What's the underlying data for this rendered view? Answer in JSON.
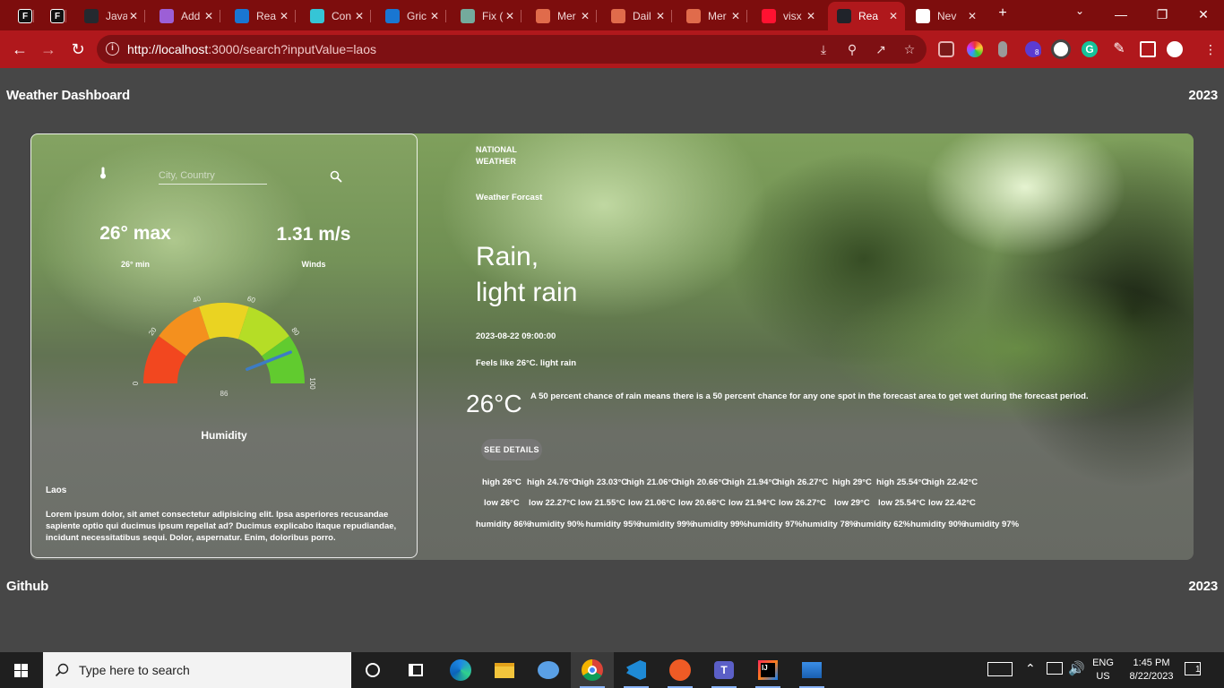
{
  "browser": {
    "tabs": [
      {
        "title": "",
        "icon": "figma-f",
        "color": "#1e1e1e",
        "glyph": "F"
      },
      {
        "title": "",
        "icon": "figma-f",
        "color": "#1e1e1e",
        "glyph": "F"
      },
      {
        "title": "Java",
        "icon": "github-icon",
        "color": "#24292f",
        "glyph": ""
      },
      {
        "title": "Add",
        "icon": "avatar-icon",
        "color": "#9c5fd6",
        "glyph": ""
      },
      {
        "title": "Rea",
        "icon": "mui-icon",
        "color": "#1976d2",
        "glyph": ""
      },
      {
        "title": "Con",
        "icon": "lightning-icon",
        "color": "#35c5d6",
        "glyph": ""
      },
      {
        "title": "Gric",
        "icon": "mui-icon",
        "color": "#1976d2",
        "glyph": ""
      },
      {
        "title": "Fix (",
        "icon": "chatgpt-icon",
        "color": "#74aa9c",
        "glyph": ""
      },
      {
        "title": "Mer",
        "icon": "octopus-icon",
        "color": "#e06b4b",
        "glyph": ""
      },
      {
        "title": "Dail",
        "icon": "octopus-icon",
        "color": "#e06b4b",
        "glyph": ""
      },
      {
        "title": "Mer",
        "icon": "octopus-icon",
        "color": "#e06b4b",
        "glyph": ""
      },
      {
        "title": "visx",
        "icon": "visx-icon",
        "color": "#ff1231",
        "glyph": ""
      },
      {
        "title": "Rea",
        "icon": "react-icon",
        "color": "#20232a",
        "glyph": ""
      },
      {
        "title": "Nev",
        "icon": "chrome-icon",
        "color": "#ffffff",
        "glyph": ""
      }
    ],
    "url_host": "http://localhost",
    "url_rest": ":3000/search?inputValue=laos",
    "accent": "#b0181c"
  },
  "page": {
    "header_title": "Weather Dashboard",
    "header_year": "2023",
    "footer_link": "Github",
    "footer_year": "2023"
  },
  "left_panel": {
    "search_placeholder": "City, Country",
    "max_temp": "26° max",
    "min_temp": "26° min",
    "wind_speed": "1.31 m/s",
    "wind_label": "Winds",
    "gauge": {
      "title": "Humidity",
      "value": 86,
      "value_label": "86",
      "ticks": [
        "0",
        "20",
        "40",
        "60",
        "80",
        "100"
      ],
      "colors": [
        "#f2471f",
        "#f4901e",
        "#ead322",
        "#b5dd26",
        "#61cb2f"
      ],
      "needle_color": "#3d7cc4"
    },
    "city": "Laos",
    "description": "Lorem ipsum dolor, sit amet consectetur adipisicing elit. Ipsa asperiores recusandae sapiente optio qui ducimus ipsum repellat ad? Ducimus explicabo itaque repudiandae, incidunt necessitatibus sequi. Dolor, aspernatur. Enim, doloribus porro."
  },
  "right_panel": {
    "brand_line1": "National",
    "brand_line2": "Weather",
    "forecast_label": "Weather Forcast",
    "condition_line1": "Rain,",
    "condition_line2": "light rain",
    "datetime": "2023-08-22 09:00:00",
    "feels_like": "Feels like 26°C. light rain",
    "temperature": "26°C",
    "rain_note": "A 50 percent chance of rain means there is a 50 percent chance for any one spot in the forecast area to get wet during the forecast period.",
    "details_button": "SEE DETAILS",
    "highs": [
      "high 26°C",
      "high 24.76°C",
      "high 23.03°C",
      "high 21.06°C",
      "high 20.66°C",
      "high 21.94°C",
      "high 26.27°C",
      "high 29°C",
      "high 25.54°C",
      "high 22.42°C"
    ],
    "lows": [
      "low 26°C",
      "low 22.27°C",
      "low 21.55°C",
      "low 21.06°C",
      "low 20.66°C",
      "low 21.94°C",
      "low 26.27°C",
      "low 29°C",
      "low 25.54°C",
      "low 22.42°C"
    ],
    "humidity": [
      "humidity 86%",
      "humidity 90%",
      "humidity 95%",
      "humidity 99%",
      "humidity 99%",
      "humidity 97%",
      "humidity 78%",
      "humidity 62%",
      "humidity 90%",
      "humidity 97%"
    ]
  },
  "taskbar": {
    "search_placeholder": "Type here to search",
    "time": "1:45 PM",
    "date": "8/22/2023",
    "language": "ENG",
    "region": "US",
    "notification_count": "1",
    "extension_badge": "8"
  }
}
